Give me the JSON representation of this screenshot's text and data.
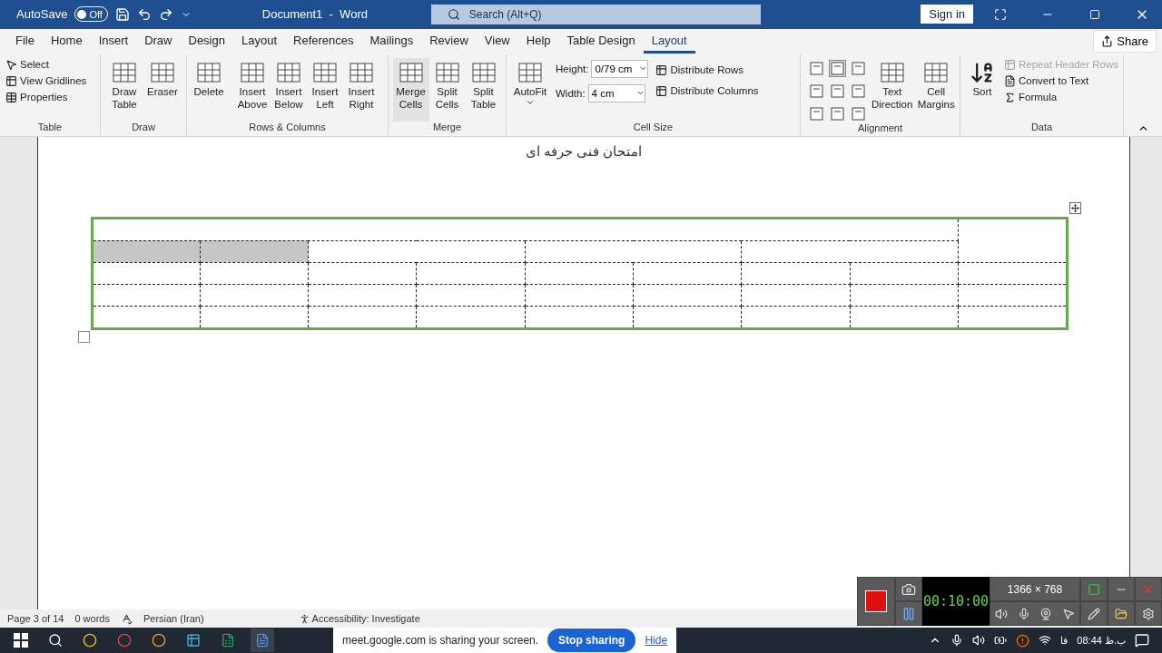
{
  "title_bar": {
    "autosave_label": "AutoSave",
    "autosave": {
      "on": false,
      "label": "Off"
    },
    "title": "Document1  -  Word",
    "search": {
      "placeholder": "Search (Alt+Q)"
    },
    "sign_in": "Sign in"
  },
  "tabs": [
    {
      "label": "File",
      "selected": false
    },
    {
      "label": "Home",
      "selected": false
    },
    {
      "label": "Insert",
      "selected": false
    },
    {
      "label": "Draw",
      "selected": false
    },
    {
      "label": "Design",
      "selected": false
    },
    {
      "label": "Layout",
      "selected": false
    },
    {
      "label": "References",
      "selected": false
    },
    {
      "label": "Mailings",
      "selected": false
    },
    {
      "label": "Review",
      "selected": false
    },
    {
      "label": "View",
      "selected": false
    },
    {
      "label": "Help",
      "selected": false
    },
    {
      "label": "Table Design",
      "selected": false
    },
    {
      "label": "Layout",
      "selected": true
    }
  ],
  "share": "Share",
  "ribbon": {
    "table_group": {
      "label": "Table",
      "items": [
        "Select",
        "View Gridlines",
        "Properties"
      ]
    },
    "draw_group": {
      "label": "Draw",
      "buttons": [
        "Draw Table",
        "Eraser"
      ]
    },
    "rows_columns_group": {
      "label": "Rows & Columns",
      "buttons": [
        "Delete",
        "Insert Above",
        "Insert Below",
        "Insert Left",
        "Insert Right"
      ]
    },
    "merge_group": {
      "label": "Merge",
      "buttons": [
        {
          "label": "Merge Cells",
          "hovered": true
        },
        {
          "label": "Split Cells",
          "hovered": false
        },
        {
          "label": "Split Table",
          "hovered": false
        }
      ]
    },
    "cell_size_group": {
      "label": "Cell Size",
      "autofit": "AutoFit",
      "height": {
        "label": "Height:",
        "value": "0/79 cm"
      },
      "width": {
        "label": "Width:",
        "value": "4 cm"
      },
      "distribute": [
        "Distribute Rows",
        "Distribute Columns"
      ]
    },
    "alignment_group": {
      "label": "Alignment",
      "alignments": [
        {
          "selected": false
        },
        {
          "selected": true
        },
        {
          "selected": false
        },
        {
          "selected": false
        },
        {
          "selected": false
        },
        {
          "selected": false
        },
        {
          "selected": false
        },
        {
          "selected": false
        },
        {
          "selected": false
        }
      ],
      "buttons": [
        "Text Direction",
        "Cell Margins"
      ]
    },
    "data_group": {
      "label": "Data",
      "sort": "Sort",
      "items": [
        {
          "label": "Repeat Header Rows",
          "disabled": true
        },
        {
          "label": "Convert to Text",
          "disabled": false
        },
        {
          "label": "Formula",
          "disabled": false
        }
      ]
    }
  },
  "document": {
    "heading": "امتحان فنی حرفه ای",
    "table": {
      "rows": [
        {
          "cells": [
            {
              "colspan": 8,
              "selected": false
            },
            {
              "rowspan": 2,
              "selected": false
            }
          ]
        },
        {
          "cells": [
            {
              "selected": true
            },
            {
              "selected": true
            },
            {
              "colspan": 2,
              "selected": false
            },
            {
              "colspan": 2,
              "selected": false
            },
            {
              "colspan": 2,
              "selected": false
            }
          ]
        },
        {
          "cells": [
            {
              "selected": false
            },
            {
              "selected": false
            },
            {
              "selected": false
            },
            {
              "selected": false
            },
            {
              "selected": false
            },
            {
              "selected": false
            },
            {
              "selected": false
            },
            {
              "selected": false
            },
            {
              "selected": false
            }
          ]
        },
        {
          "cells": [
            {
              "selected": false
            },
            {
              "selected": false
            },
            {
              "selected": false
            },
            {
              "selected": false
            },
            {
              "selected": false
            },
            {
              "selected": false
            },
            {
              "selected": false
            },
            {
              "selected": false
            },
            {
              "selected": false
            }
          ]
        },
        {
          "cells": [
            {
              "selected": false
            },
            {
              "selected": false
            },
            {
              "selected": false
            },
            {
              "selected": false
            },
            {
              "selected": false
            },
            {
              "selected": false
            },
            {
              "selected": false
            },
            {
              "selected": false
            },
            {
              "selected": false
            }
          ]
        }
      ]
    }
  },
  "status_bar": {
    "page": "Page 3 of 14",
    "words": "0 words",
    "language": "Persian (Iran)",
    "accessibility": "Accessibility: Investigate"
  },
  "share_banner": {
    "message": "meet.google.com is sharing your screen.",
    "stop": "Stop sharing",
    "hide": "Hide"
  },
  "recorder": {
    "timer": "00:10:00",
    "resolution": "1366 × 768"
  },
  "taskbar": {
    "input_language": "فا",
    "clock": "08:44 ب.ظ"
  }
}
